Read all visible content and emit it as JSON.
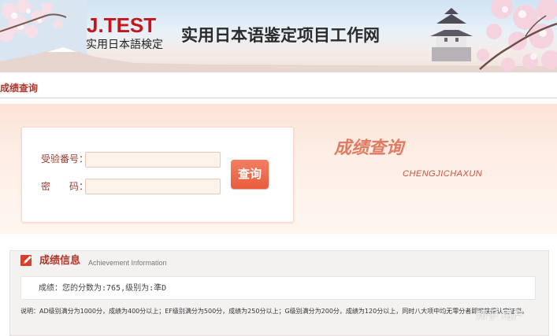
{
  "header": {
    "logo_main": "J.TEST",
    "logo_sub": "实用日本語検定",
    "site_title": "实用日本语鉴定项目工作网"
  },
  "breadcrumb": {
    "label": "成绩查询"
  },
  "query_form": {
    "exam_number_label": "受验番号：",
    "exam_number_value": "",
    "password_label": "密　　码：",
    "password_value": "",
    "submit_label": "查询"
  },
  "decoration": {
    "title": "成绩查询",
    "subtitle": "CHENGJICHAXUN"
  },
  "result": {
    "title": "成绩信息",
    "title_en": "Achievement Information",
    "score_text": "成绩：您的分数为:765,级别为:準D",
    "note": "说明：AD级别满分为1000分，成绩为400分以上；EF级别满分为500分，成绩为250分以上；G级别满分为200分，成绩为120分以上，同时八大项中均无零分者即可获得认定证书。"
  },
  "watermark": "知乎 用户",
  "colors": {
    "accent_red": "#c4161c",
    "crumb_red": "#b0362a",
    "button_orange": "#e85b3c",
    "band_peach": "#fbe3d6"
  }
}
